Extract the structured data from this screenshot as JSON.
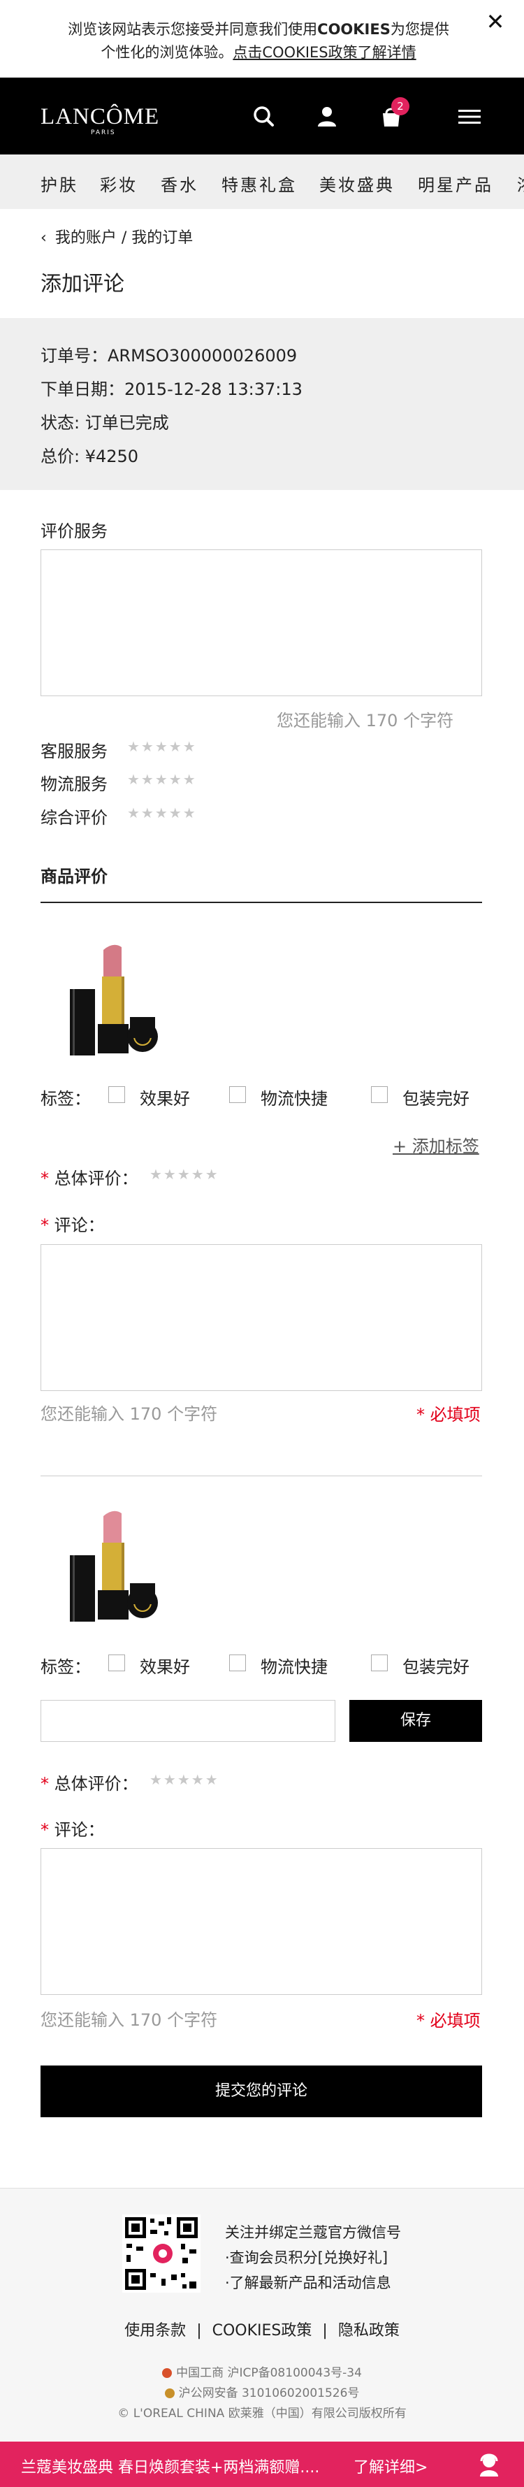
{
  "cookie": {
    "text_line1": "浏览该网站表示您接受并同意我们使用",
    "cookies_word": "COOKIES",
    "text_line1_end": "为您提供",
    "text_line2": "个性化的浏览体验。",
    "link": "点击COOKIES政策了解详情",
    "close": "✕"
  },
  "header": {
    "logo": "LANCÔME",
    "logo_sub": "PARIS",
    "cart_count": "2"
  },
  "nav": [
    "护肤",
    "彩妆",
    "香水",
    "特惠礼盒",
    "美妆盛典",
    "明星产品",
    "浓"
  ],
  "breadcrumb": {
    "arrow": "‹",
    "account": "我的账户",
    "sep": "/",
    "orders": "我的订单"
  },
  "page_title": "添加评论",
  "order": {
    "number": "订单号：ARMSO300000026009",
    "date": "下单日期：2015-12-28 13:37:13",
    "status": "状态: 订单已完成",
    "total": "总价: ¥4250"
  },
  "service": {
    "title": "评价服务",
    "remaining": "您还能输入 170 个字符",
    "ratings": [
      "客服服务",
      "物流服务",
      "综合评价"
    ],
    "stars": "★★★★★"
  },
  "products_title": "商品评价",
  "product_review": {
    "tags_label": "标签：",
    "tags": [
      "效果好",
      "物流快捷",
      "包装完好"
    ],
    "add_tag": "+ 添加标签",
    "required_mark": "*",
    "overall_label": "总体评价：",
    "comment_label": "评论：",
    "remaining": "您还能输入 170 个字符",
    "required_text": "* 必填项",
    "save_button": "保存"
  },
  "submit_button": "提交您的评论",
  "footer": {
    "wechat_lines": [
      "关注并绑定兰蔻官方微信号",
      "·查询会员积分[兑换好礼]",
      "·了解最新产品和活动信息"
    ],
    "links": [
      "使用条款",
      "COOKIES政策",
      "隐私政策"
    ],
    "sep": "|",
    "icp1": "中国工商    沪ICP备08100043号-34",
    "icp2": "沪公网安备 31010602001526号",
    "copyright": "© L'OREAL CHINA 欧莱雅（中国）有限公司版权所有"
  },
  "promo": {
    "text": "兰蔻美妆盛典 春日焕颜套装+两档满额赠....",
    "link": "了解详细>"
  },
  "colors": {
    "accent": "#e2235e",
    "required": "#e2001a",
    "header_bg": "#000000",
    "nav_bg": "#efefef"
  }
}
